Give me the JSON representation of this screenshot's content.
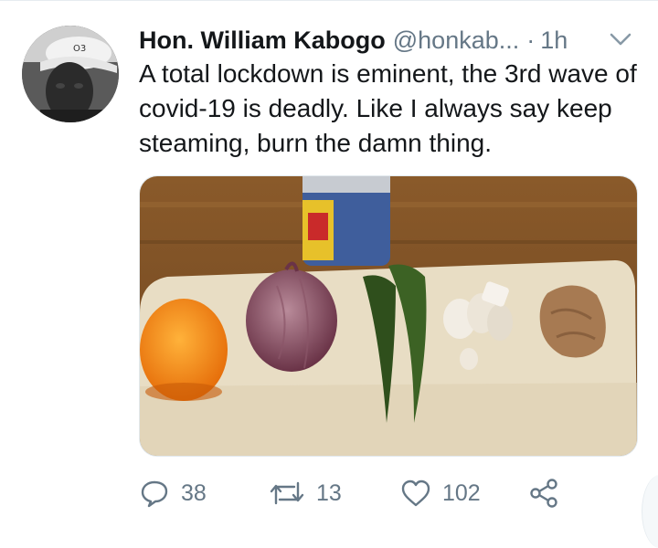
{
  "tweet": {
    "author_name": "Hon. William Kabogo",
    "author_handle": "@honkab...",
    "separator": "·",
    "time": "1h",
    "text": "A total lockdown is eminent, the 3rd wave of covid-19 is deadly.  Like I always say keep steaming, burn the damn thing.",
    "avatar_icon": "user-avatar-photo",
    "media_icon": "photo-orange-onion-leaves-garlic-ginger-on-board",
    "caret_icon": "chevron-down-icon"
  },
  "actions": {
    "reply": {
      "icon": "reply-icon",
      "count": "38"
    },
    "retweet": {
      "icon": "retweet-icon",
      "count": "13"
    },
    "like": {
      "icon": "heart-icon",
      "count": "102"
    },
    "share": {
      "icon": "share-icon"
    }
  },
  "colors": {
    "text": "#14171a",
    "muted": "#657786",
    "border": "#e6ecf0"
  }
}
